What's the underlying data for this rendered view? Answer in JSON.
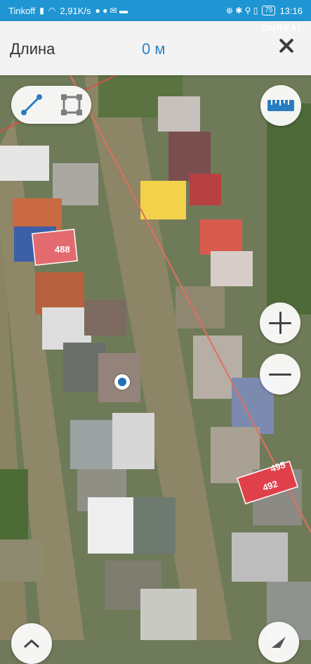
{
  "status_bar": {
    "carrier": "Tinkoff",
    "speed": "2,91K/s",
    "battery": "75",
    "time": "13:16"
  },
  "watermark": "ONREAL",
  "header": {
    "title": "Длина",
    "value": "0 м"
  },
  "map": {
    "parcel_labels": [
      "488",
      "495",
      "492"
    ]
  },
  "icons": {
    "line_mode": "line-measure-icon",
    "area_mode": "area-measure-icon",
    "ruler": "ruler-icon",
    "zoom_in": "plus-icon",
    "zoom_out": "minus-icon",
    "close": "close-icon"
  },
  "colors": {
    "status_bar": "#1f95d3",
    "header_bg": "#f3f3f3",
    "accent": "#2d86c4",
    "parcel_red": "#e0404a"
  }
}
